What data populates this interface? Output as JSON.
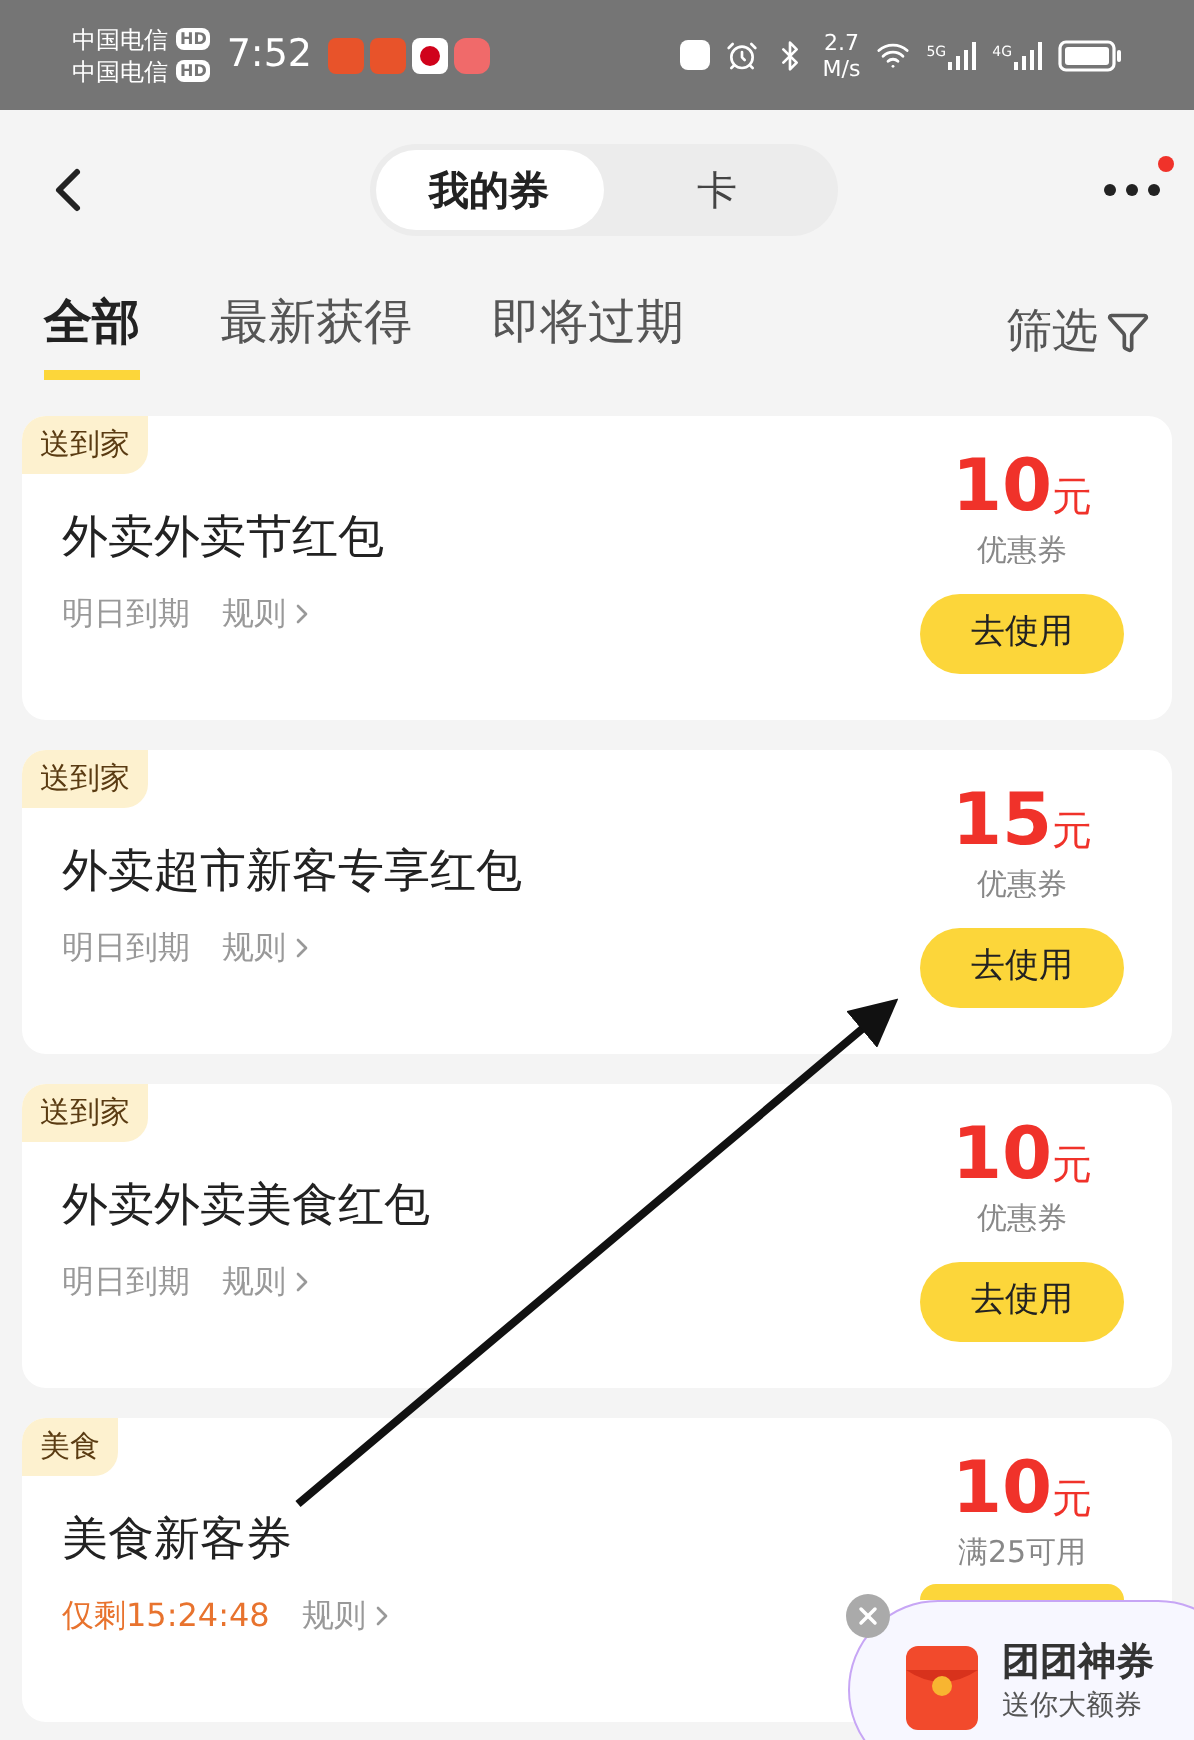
{
  "status_bar": {
    "carriers": [
      "中国电信",
      "中国电信"
    ],
    "hd_badges": [
      "HD",
      "HD"
    ],
    "time": "7:52",
    "speed_value": "2.7",
    "speed_unit": "M/s",
    "network_labels": [
      "5G",
      "4G"
    ]
  },
  "header": {
    "segments": [
      {
        "label": "我的券",
        "selected": true
      },
      {
        "label": "卡",
        "selected": false
      }
    ],
    "has_notification": true
  },
  "tabs": [
    {
      "label": "全部",
      "selected": true
    },
    {
      "label": "最新获得",
      "selected": false
    },
    {
      "label": "即将过期",
      "selected": false
    }
  ],
  "filter": {
    "label": "筛选"
  },
  "coupons": [
    {
      "tag": "送到家",
      "title": "外卖外卖节红包",
      "expiry": "明日到期",
      "urgent": false,
      "rules": "规则",
      "amount": "10",
      "unit": "元",
      "condition": "优惠券",
      "action": "去使用"
    },
    {
      "tag": "送到家",
      "title": "外卖超市新客专享红包",
      "expiry": "明日到期",
      "urgent": false,
      "rules": "规则",
      "amount": "15",
      "unit": "元",
      "condition": "优惠券",
      "action": "去使用"
    },
    {
      "tag": "送到家",
      "title": "外卖外卖美食红包",
      "expiry": "明日到期",
      "urgent": false,
      "rules": "规则",
      "amount": "10",
      "unit": "元",
      "condition": "优惠券",
      "action": "去使用"
    },
    {
      "tag": "美食",
      "title": "美食新客券",
      "expiry": "仅剩15:24:48",
      "urgent": true,
      "rules": "规则",
      "amount": "10",
      "unit": "元",
      "condition": "满25可用"
    }
  ],
  "promo": {
    "title": "团团神券",
    "subtitle": "送你大额券"
  }
}
